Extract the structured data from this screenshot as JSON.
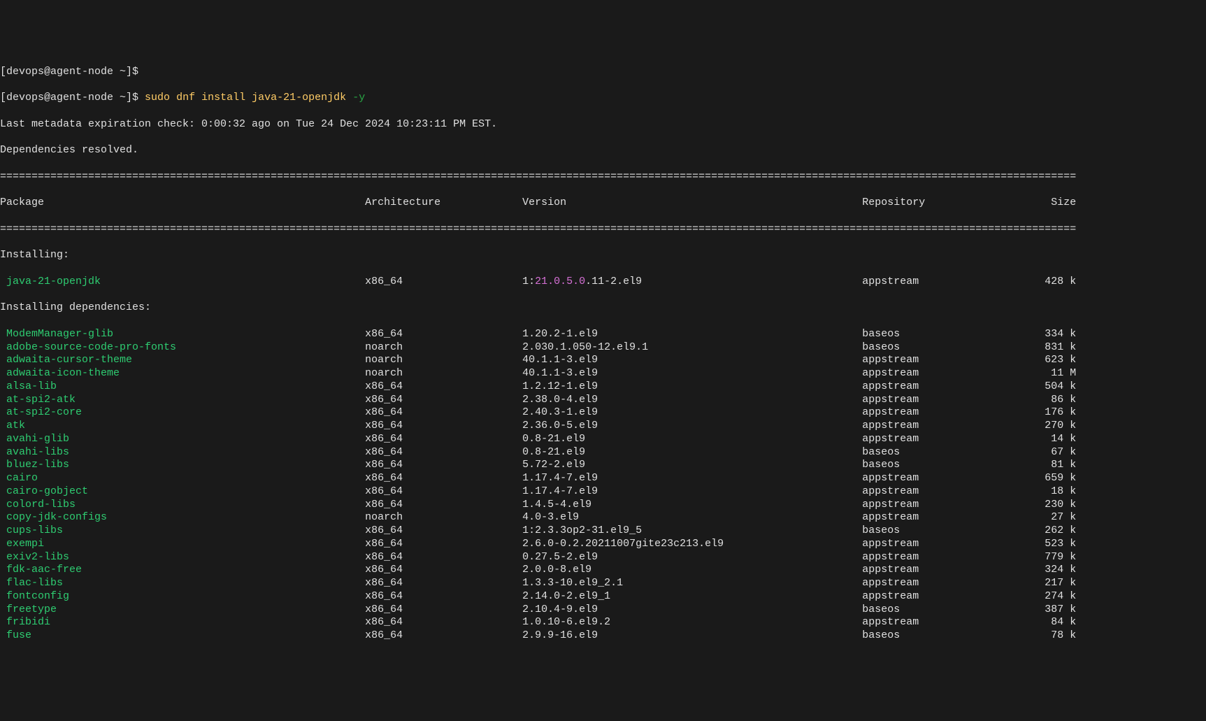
{
  "prompt1": "[devops@agent-node ~]$",
  "prompt2": "[devops@agent-node ~]$ ",
  "command": {
    "full": "sudo dnf install java-21-openjdk -y",
    "sudo": "sudo",
    "dnf": "dnf",
    "install": "install",
    "pkg": "java-21-openjdk",
    "flag": "-y"
  },
  "metadata_line": "Last metadata expiration check: 0:00:32 ago on Tue 24 Dec 2024 10:23:11 PM EST.",
  "deps_resolved": "Dependencies resolved.",
  "headers": {
    "package": "Package",
    "arch": "Architecture",
    "version": "Version",
    "repo": "Repository",
    "size": "Size"
  },
  "section_installing": "Installing:",
  "main_pkg": {
    "name": "java-21-openjdk",
    "arch": "x86_64",
    "version_prefix": "1:",
    "version_highlight": "21.0.5.0",
    "version_suffix": ".11-2.el9",
    "repo": "appstream",
    "size": "428 k"
  },
  "section_deps": "Installing dependencies:",
  "deps": [
    {
      "name": "ModemManager-glib",
      "arch": "x86_64",
      "version": "1.20.2-1.el9",
      "repo": "baseos",
      "size": "334 k"
    },
    {
      "name": "adobe-source-code-pro-fonts",
      "arch": "noarch",
      "version": "2.030.1.050-12.el9.1",
      "repo": "baseos",
      "size": "831 k"
    },
    {
      "name": "adwaita-cursor-theme",
      "arch": "noarch",
      "version": "40.1.1-3.el9",
      "repo": "appstream",
      "size": "623 k"
    },
    {
      "name": "adwaita-icon-theme",
      "arch": "noarch",
      "version": "40.1.1-3.el9",
      "repo": "appstream",
      "size": "11 M"
    },
    {
      "name": "alsa-lib",
      "arch": "x86_64",
      "version": "1.2.12-1.el9",
      "repo": "appstream",
      "size": "504 k"
    },
    {
      "name": "at-spi2-atk",
      "arch": "x86_64",
      "version": "2.38.0-4.el9",
      "repo": "appstream",
      "size": "86 k"
    },
    {
      "name": "at-spi2-core",
      "arch": "x86_64",
      "version": "2.40.3-1.el9",
      "repo": "appstream",
      "size": "176 k"
    },
    {
      "name": "atk",
      "arch": "x86_64",
      "version": "2.36.0-5.el9",
      "repo": "appstream",
      "size": "270 k"
    },
    {
      "name": "avahi-glib",
      "arch": "x86_64",
      "version": "0.8-21.el9",
      "repo": "appstream",
      "size": "14 k"
    },
    {
      "name": "avahi-libs",
      "arch": "x86_64",
      "version": "0.8-21.el9",
      "repo": "baseos",
      "size": "67 k"
    },
    {
      "name": "bluez-libs",
      "arch": "x86_64",
      "version": "5.72-2.el9",
      "repo": "baseos",
      "size": "81 k"
    },
    {
      "name": "cairo",
      "arch": "x86_64",
      "version": "1.17.4-7.el9",
      "repo": "appstream",
      "size": "659 k"
    },
    {
      "name": "cairo-gobject",
      "arch": "x86_64",
      "version": "1.17.4-7.el9",
      "repo": "appstream",
      "size": "18 k"
    },
    {
      "name": "colord-libs",
      "arch": "x86_64",
      "version": "1.4.5-4.el9",
      "repo": "appstream",
      "size": "230 k"
    },
    {
      "name": "copy-jdk-configs",
      "arch": "noarch",
      "version": "4.0-3.el9",
      "repo": "appstream",
      "size": "27 k"
    },
    {
      "name": "cups-libs",
      "arch": "x86_64",
      "version": "1:2.3.3op2-31.el9_5",
      "repo": "baseos",
      "size": "262 k"
    },
    {
      "name": "exempi",
      "arch": "x86_64",
      "version": "2.6.0-0.2.20211007gite23c213.el9",
      "repo": "appstream",
      "size": "523 k"
    },
    {
      "name": "exiv2-libs",
      "arch": "x86_64",
      "version": "0.27.5-2.el9",
      "repo": "appstream",
      "size": "779 k"
    },
    {
      "name": "fdk-aac-free",
      "arch": "x86_64",
      "version": "2.0.0-8.el9",
      "repo": "appstream",
      "size": "324 k"
    },
    {
      "name": "flac-libs",
      "arch": "x86_64",
      "version": "1.3.3-10.el9_2.1",
      "repo": "appstream",
      "size": "217 k"
    },
    {
      "name": "fontconfig",
      "arch": "x86_64",
      "version": "2.14.0-2.el9_1",
      "repo": "appstream",
      "size": "274 k"
    },
    {
      "name": "freetype",
      "arch": "x86_64",
      "version": "2.10.4-9.el9",
      "repo": "baseos",
      "size": "387 k"
    },
    {
      "name": "fribidi",
      "arch": "x86_64",
      "version": "1.0.10-6.el9.2",
      "repo": "appstream",
      "size": "84 k"
    },
    {
      "name": "fuse",
      "arch": "x86_64",
      "version": "2.9.9-16.el9",
      "repo": "baseos",
      "size": "78 k"
    }
  ],
  "col_widths": {
    "name": 58,
    "arch": 25,
    "version": 54,
    "repo": 27,
    "size": 7
  }
}
